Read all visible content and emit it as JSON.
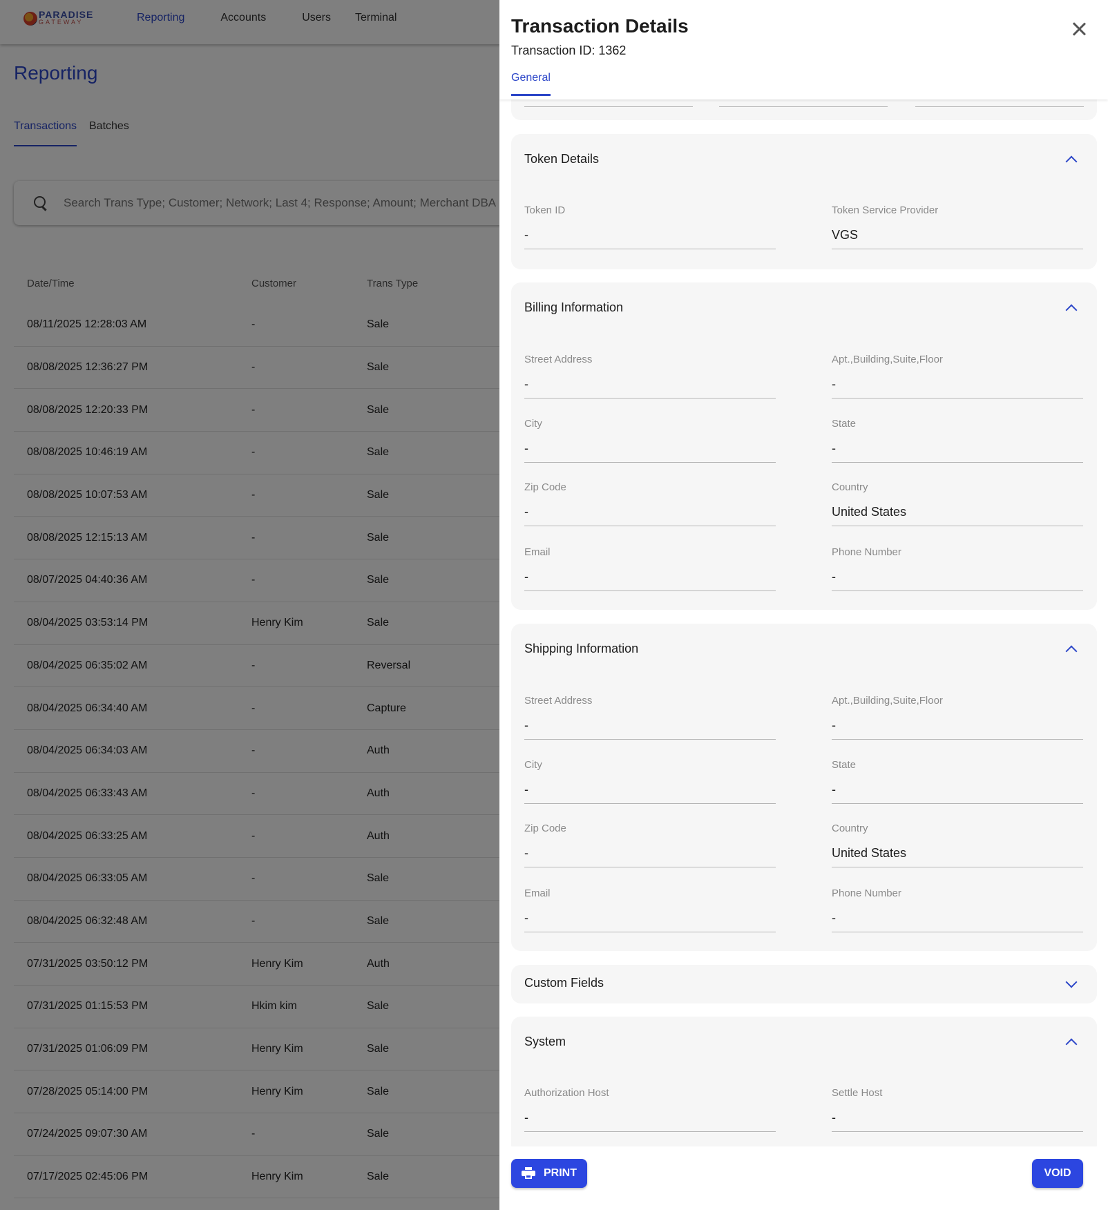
{
  "app": {
    "logo": {
      "line1": "PARADISE",
      "line2": "GATEWAY"
    },
    "nav": [
      "Reporting",
      "Accounts",
      "Users",
      "Terminal"
    ],
    "page_title": "Reporting",
    "tabs": [
      "Transactions",
      "Batches"
    ],
    "search": {
      "placeholder": "Search Trans Type; Customer; Network; Last 4; Response; Amount; Merchant DBA"
    },
    "table": {
      "headers": [
        "Date/Time",
        "Customer",
        "Trans Type"
      ],
      "rows": [
        [
          "08/11/2025 12:28:03 AM",
          "-",
          "Sale"
        ],
        [
          "08/08/2025 12:36:27 PM",
          "-",
          "Sale"
        ],
        [
          "08/08/2025 12:20:33 PM",
          "-",
          "Sale"
        ],
        [
          "08/08/2025 10:46:19 AM",
          "-",
          "Sale"
        ],
        [
          "08/08/2025 10:07:53 AM",
          "-",
          "Sale"
        ],
        [
          "08/08/2025 12:15:13 AM",
          "-",
          "Sale"
        ],
        [
          "08/07/2025 04:40:36 AM",
          "-",
          "Sale"
        ],
        [
          "08/04/2025 03:53:14 PM",
          "Henry Kim",
          "Sale"
        ],
        [
          "08/04/2025 06:35:02 AM",
          "-",
          "Reversal"
        ],
        [
          "08/04/2025 06:34:40 AM",
          "-",
          "Capture"
        ],
        [
          "08/04/2025 06:34:03 AM",
          "-",
          "Auth"
        ],
        [
          "08/04/2025 06:33:43 AM",
          "-",
          "Auth"
        ],
        [
          "08/04/2025 06:33:25 AM",
          "-",
          "Auth"
        ],
        [
          "08/04/2025 06:33:05 AM",
          "-",
          "Sale"
        ],
        [
          "08/04/2025 06:32:48 AM",
          "-",
          "Sale"
        ],
        [
          "07/31/2025 03:50:12 PM",
          "Henry Kim",
          "Auth"
        ],
        [
          "07/31/2025 01:15:53 PM",
          "Hkim kim",
          "Sale"
        ],
        [
          "07/31/2025 01:06:09 PM",
          "Henry Kim",
          "Sale"
        ],
        [
          "07/28/2025 05:14:00 PM",
          "Henry Kim",
          "Sale"
        ],
        [
          "07/24/2025 09:07:30 AM",
          "-",
          "Sale"
        ],
        [
          "07/17/2025 02:45:06 PM",
          "Henry Kim",
          "Sale"
        ]
      ]
    }
  },
  "drawer": {
    "title": "Transaction Details",
    "subtitle": "Transaction ID: 1362",
    "tab": "General",
    "token": {
      "heading": "Token Details",
      "token_id_label": "Token ID",
      "token_id_value": "-",
      "provider_label": "Token Service Provider",
      "provider_value": "VGS"
    },
    "billing": {
      "heading": "Billing Information",
      "street_label": "Street Address",
      "street_value": "-",
      "apt_label": "Apt.,Building,Suite,Floor",
      "apt_value": "-",
      "city_label": "City",
      "city_value": "-",
      "state_label": "State",
      "state_value": "-",
      "zip_label": "Zip Code",
      "zip_value": "-",
      "country_label": "Country",
      "country_value": "United States",
      "email_label": "Email",
      "email_value": "-",
      "phone_label": "Phone Number",
      "phone_value": "-"
    },
    "shipping": {
      "heading": "Shipping Information",
      "street_label": "Street Address",
      "street_value": "-",
      "apt_label": "Apt.,Building,Suite,Floor",
      "apt_value": "-",
      "city_label": "City",
      "city_value": "-",
      "state_label": "State",
      "state_value": "-",
      "zip_label": "Zip Code",
      "zip_value": "-",
      "country_label": "Country",
      "country_value": "United States",
      "email_label": "Email",
      "email_value": "-",
      "phone_label": "Phone Number",
      "phone_value": "-"
    },
    "custom_fields": {
      "heading": "Custom Fields"
    },
    "system": {
      "heading": "System",
      "auth_host_label": "Authorization Host",
      "auth_host_value": "-",
      "settle_host_label": "Settle Host",
      "settle_host_value": "-"
    },
    "buttons": {
      "print": "PRINT",
      "void": "VOID"
    }
  },
  "colors": {
    "accent": "#2c46c8",
    "button": "#2c46e0",
    "overlay": "rgba(0,0,0,0.5)"
  }
}
